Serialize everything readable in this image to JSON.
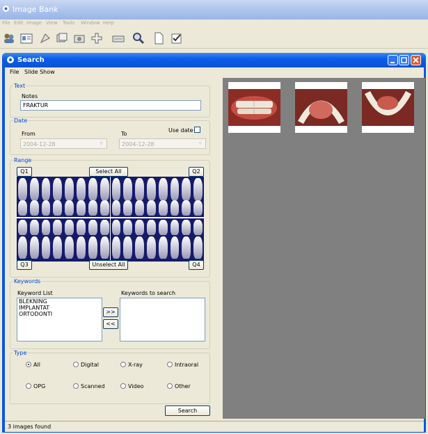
{
  "app": {
    "title": "Image Bank",
    "menu": [
      "File",
      "Edit",
      "Image",
      "View",
      "Tools",
      "Window",
      "Help"
    ]
  },
  "window": {
    "title": "Search",
    "menu": [
      "File",
      "Slide Show"
    ]
  },
  "text_group": {
    "legend": "Text",
    "notes_label": "Notes",
    "notes_value": "FRAKTUR"
  },
  "date_group": {
    "legend": "Date",
    "from_label": "From",
    "to_label": "To",
    "use_date_label": "Use date",
    "from_value": "2004-12-28",
    "to_value": "2004-12-28",
    "use_date_checked": false
  },
  "range_group": {
    "legend": "Range",
    "q1": "Q1",
    "q2": "Q2",
    "q3": "Q3",
    "q4": "Q4",
    "select_all": "Select All",
    "unselect_all": "Unselect All"
  },
  "keywords_group": {
    "legend": "Keywords",
    "list_label": "Keyword List",
    "search_label": "Keywords to search",
    "items": [
      "BLEKNING",
      "IMPLANTAT",
      "ORTODONTI"
    ],
    "add_button": ">>",
    "remove_button": "<<"
  },
  "type_group": {
    "legend": "Type",
    "options": [
      "All",
      "Digital",
      "X-ray",
      "Intraoral",
      "OPG",
      "Scanned",
      "Video",
      "Other"
    ],
    "selected": "All"
  },
  "search_button": "Search",
  "status": "3 images found",
  "colors": {
    "titlebar_blue": "#0a5ee8",
    "group_legend": "#0046d5",
    "gallery_bg": "#808080",
    "teeth_bg": "#151a6b"
  }
}
